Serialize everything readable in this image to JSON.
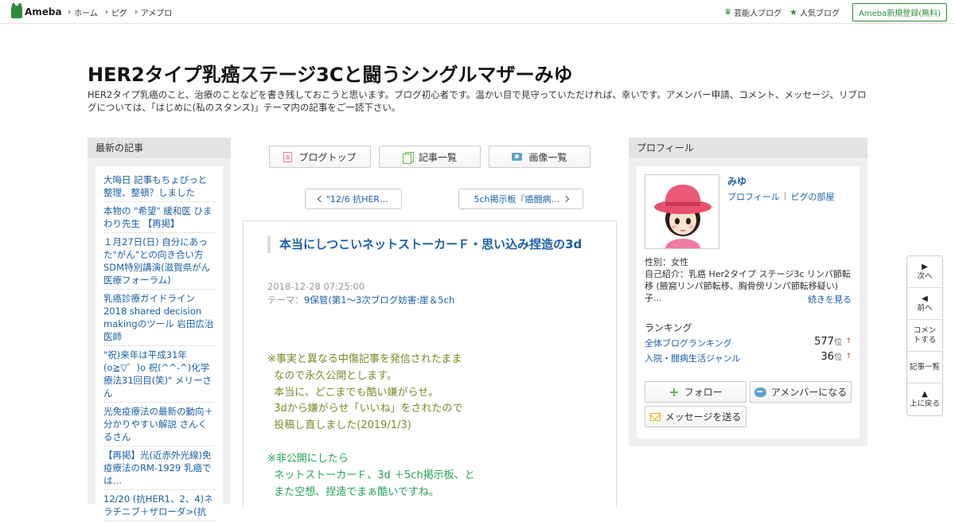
{
  "header": {
    "logo_text": "Ameba",
    "nav": [
      "ホーム",
      "ピグ",
      "アメブロ"
    ],
    "right_links": {
      "celebrity": "芸能人ブログ",
      "popular": "人気ブログ"
    },
    "signup": "Ameba新規登録(無料)"
  },
  "blog": {
    "title": "HER2タイプ乳癌ステージ3Cと闘うシングルマザーみゆ",
    "description": "HER2タイプ乳癌のこと、治療のことなどを書き残しておこうと思います。ブログ初心者です。温かい目で見守っていただければ、幸いです。アメンバー申請、コメント、メッセージ、リブログについては、「はじめに(私のスタンス)」テーマ内の記事をご一読下さい。"
  },
  "sidebar": {
    "heading": "最新の記事",
    "items": [
      "大晦日 記事もちょびっと整理、整頓？しました",
      "本物の \"希望\" 緩和医 ひまわり先生 【再掲】",
      "１月27日(日) 自分にあった\"がん\"との向き合い方 SDM特別講演(滋賀県がん医療フォーラム)",
      "乳癌診療ガイドライン2018 shared decision makingのツール 岩田広治医師",
      "\"祝)来年は平成31年(o≧▽゜)o 祝(^^-^)化学療法31回目(笑)\" メリーさん",
      "光免疫療法の最新の動向＋分かりやすい解説 さんくるさん",
      "【再掲】光(近赤外光線)免疫療法のRM-1929 乳癌では…",
      "12/20 (抗HER1、2、4)ネラチニブ＋ザローダ>(抗"
    ]
  },
  "center": {
    "tabs": [
      "ブログトップ",
      "記事一覧",
      "画像一覧"
    ],
    "prev": "\"12/6 抗HER…",
    "next": "5ch掲示板『癌闘病…",
    "article": {
      "title": "本当にしつこいネットストーカーＦ・思い込み捏造の3d",
      "date": "2018-12-28 07:25:00",
      "theme_label": "テーマ：",
      "theme": "9保管(第1～3次ブログ妨害:崖＆5ch",
      "body_olive": [
        "※事実と異なる中傷記事を発信されたまま",
        "  なので永久公開とします。",
        "  本当に、どこまでも酷い嫌がらせ。",
        "  3dから嫌がらせ「いいね」をされたので",
        "  投稿し直しました(2019/1/3)"
      ],
      "body_green": [
        "※非公開にしたら",
        "  ネットストーカーＦ、3d ＋5ch掲示板、と",
        "  また空想、捏造でまぁ酷いですね。"
      ]
    }
  },
  "profile": {
    "heading": "プロフィール",
    "name": "みゆ",
    "link_profile": "プロフィール",
    "link_room": "ピグの部屋",
    "gender": "性別：女性",
    "intro": "自己紹介：乳癌 Her2タイプ ステージ3c リンパ節転移 (腋窩リンパ節転移、胸骨傍リンパ節転移疑い) 子...",
    "more": "続きを見る",
    "ranking_heading": "ランキング",
    "rankings": [
      {
        "label": "全体ブログランキング",
        "value": "577",
        "unit": "位",
        "trend": "↑"
      },
      {
        "label": "入院・闘病生活ジャンル",
        "value": "36",
        "unit": "位",
        "trend": "↑"
      }
    ],
    "follow": "フォロー",
    "amember": "アメンバーになる",
    "message": "メッセージを送る"
  },
  "floatnav": {
    "next": "次へ",
    "prev": "前へ",
    "comment": "コメントする",
    "list": "記事一覧",
    "top": "上に戻る"
  },
  "colors": {
    "accent_green": "#2d8c3c",
    "link_blue": "#1a5fa8",
    "body_olive": "#7b8a2b",
    "body_green": "#27a057"
  }
}
